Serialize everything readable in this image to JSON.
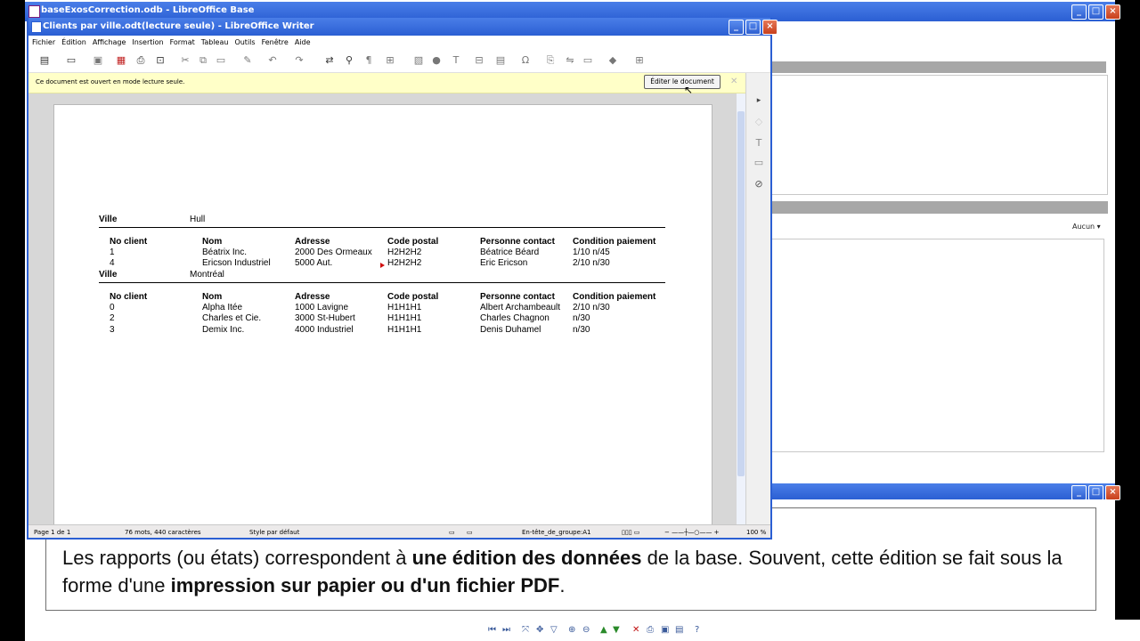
{
  "base_window": {
    "title": "baseExosCorrection.odb - LibreOffice Base",
    "sort_label": "Aucun"
  },
  "writer": {
    "title": "Clients par ville.odt(lecture seule) - LibreOffice Writer",
    "menu": [
      "Fichier",
      "Édition",
      "Affichage",
      "Insertion",
      "Format",
      "Tableau",
      "Outils",
      "Fenêtre",
      "Aide"
    ],
    "infobar": {
      "message": "Ce document est ouvert en mode lecture seule.",
      "edit_button": "Éditer le document"
    },
    "status": {
      "page": "Page 1 de 1",
      "words": "76 mots, 440 caractères",
      "style": "Style par défaut",
      "section": "En-tête_de_groupe:A1",
      "zoom": "100 %"
    }
  },
  "report": {
    "columns": [
      "No client",
      "Nom",
      "Adresse",
      "Code postal",
      "Personne contact",
      "Condition paiement"
    ],
    "group_label": "Ville",
    "groups": [
      {
        "city": "Hull",
        "rows": [
          [
            "1",
            "Béatrix Inc.",
            "2000 Des Ormeaux",
            "H2H2H2",
            "Béatrice Béard",
            "1/10 n/45"
          ],
          [
            "4",
            "Ericson Industriel",
            "5000 Aut.",
            "H2H2H2",
            "Eric Ericson",
            "2/10 n/30"
          ]
        ]
      },
      {
        "city": "Montréal",
        "rows": [
          [
            "0",
            "Alpha Itée",
            "1000 Lavigne",
            "H1H1H1",
            "Albert Archambeault",
            "2/10 n/30"
          ],
          [
            "2",
            "Charles et Cie.",
            "3000 St-Hubert",
            "H1H1H1",
            "Charles Chagnon",
            "n/30"
          ],
          [
            "3",
            "Demix Inc.",
            "4000 Industriel",
            "H1H1H1",
            "Denis Duhamel",
            "n/30"
          ]
        ]
      }
    ]
  },
  "caption": {
    "p1": "Les rapports (ou états) correspondent à ",
    "b1": "une édition des données",
    "p2": " de la base. Souvent, cette édition se fait sous la forme d'une ",
    "b2": "impression sur papier ou d'un fichier PDF",
    "p3": "."
  }
}
